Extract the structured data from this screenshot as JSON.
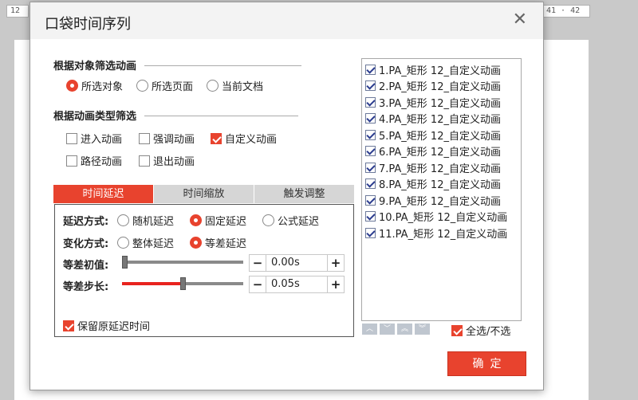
{
  "background": {
    "ruler_left": "12",
    "ruler_right": "41 · 42"
  },
  "dialog": {
    "title": "口袋时间序列",
    "close_glyph": "✕",
    "object_filter": {
      "title": "根据对象筛选动画",
      "options": [
        "所选对象",
        "所选页面",
        "当前文档"
      ],
      "selected": "所选对象"
    },
    "type_filter": {
      "title": "根据动画类型筛选",
      "options": [
        {
          "label": "进入动画",
          "checked": false
        },
        {
          "label": "强调动画",
          "checked": false
        },
        {
          "label": "自定义动画",
          "checked": true
        },
        {
          "label": "路径动画",
          "checked": false
        },
        {
          "label": "退出动画",
          "checked": false
        }
      ]
    },
    "tabs": [
      {
        "label": "时间延迟",
        "active": true
      },
      {
        "label": "时间缩放",
        "active": false
      },
      {
        "label": "触发调整",
        "active": false
      }
    ],
    "delay_panel": {
      "delay_mode_label": "延迟方式:",
      "delay_modes": [
        "随机延迟",
        "固定延迟",
        "公式延迟"
      ],
      "delay_mode_selected": "固定延迟",
      "change_mode_label": "变化方式:",
      "change_modes": [
        "整体延迟",
        "等差延迟"
      ],
      "change_mode_selected": "等差延迟",
      "initial_label": "等差初值:",
      "initial_value": "0.00s",
      "initial_slider_fraction": 0.0,
      "step_label": "等差步长:",
      "step_value": "0.05s",
      "step_slider_fraction": 0.5,
      "minus_glyph": "−",
      "plus_glyph": "+",
      "keep_original": {
        "label": "保留原延迟时间",
        "checked": true
      }
    },
    "animation_list": [
      {
        "label": "1.PA_矩形 12_自定义动画",
        "checked": true
      },
      {
        "label": "2.PA_矩形 12_自定义动画",
        "checked": true
      },
      {
        "label": "3.PA_矩形 12_自定义动画",
        "checked": true
      },
      {
        "label": "4.PA_矩形 12_自定义动画",
        "checked": true
      },
      {
        "label": "5.PA_矩形 12_自定义动画",
        "checked": true
      },
      {
        "label": "6.PA_矩形 12_自定义动画",
        "checked": true
      },
      {
        "label": "7.PA_矩形 12_自定义动画",
        "checked": true
      },
      {
        "label": "8.PA_矩形 12_自定义动画",
        "checked": true
      },
      {
        "label": "9.PA_矩形 12_自定义动画",
        "checked": true
      },
      {
        "label": "10.PA_矩形 12_自定义动画",
        "checked": true
      },
      {
        "label": "11.PA_矩形 12_自定义动画",
        "checked": true
      }
    ],
    "move_buttons": [
      "move-up-icon",
      "move-down-icon",
      "move-top-icon",
      "move-bottom-icon"
    ],
    "select_all": {
      "label": "全选/不选",
      "checked": true
    },
    "ok_label": "确定",
    "accent_color": "#e8432e"
  }
}
